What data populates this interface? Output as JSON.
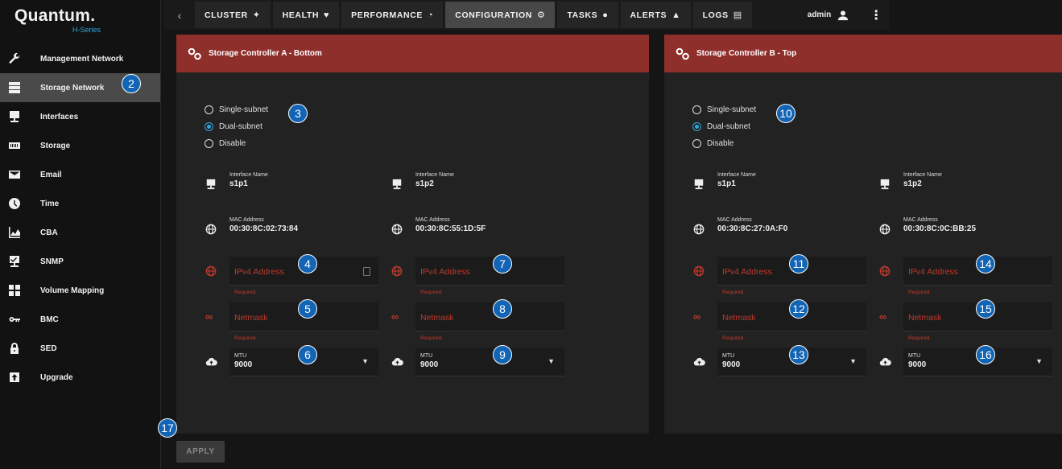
{
  "app": {
    "brand": "Quantum.",
    "series": "H-Series"
  },
  "sidebar": {
    "items": [
      {
        "label": "Management Network",
        "icon": "wrench-icon"
      },
      {
        "label": "Storage Network",
        "icon": "server-icon",
        "active": true
      },
      {
        "label": "Interfaces",
        "icon": "monitor-icon"
      },
      {
        "label": "Storage",
        "icon": "storage-icon"
      },
      {
        "label": "Email",
        "icon": "envelope-icon"
      },
      {
        "label": "Time",
        "icon": "clock-icon"
      },
      {
        "label": "CBA",
        "icon": "chart-icon"
      },
      {
        "label": "SNMP",
        "icon": "snmp-monitor-icon"
      },
      {
        "label": "Volume Mapping",
        "icon": "grid-icon"
      },
      {
        "label": "BMC",
        "icon": "key-icon"
      },
      {
        "label": "SED",
        "icon": "lock-icon"
      },
      {
        "label": "Upgrade",
        "icon": "upload-icon"
      }
    ]
  },
  "topnav": {
    "tabs": [
      {
        "label": "CLUSTER",
        "icon": "cluster-icon"
      },
      {
        "label": "HEALTH",
        "icon": "heart-icon"
      },
      {
        "label": "PERFORMANCE",
        "icon": "gauge-icon"
      },
      {
        "label": "CONFIGURATION",
        "icon": "gears-icon",
        "active": true
      },
      {
        "label": "TASKS",
        "icon": "person-icon"
      },
      {
        "label": "ALERTS",
        "icon": "bell-icon"
      },
      {
        "label": "LOGS",
        "icon": "logs-icon"
      }
    ],
    "user": "admin"
  },
  "controllers": [
    {
      "title": "Storage Controller A - Bottom",
      "radios": [
        "Single-subnet",
        "Dual-subnet",
        "Disable"
      ],
      "selected": 1,
      "ports": [
        {
          "iface_caption": "Interface Name",
          "iface": "s1p1",
          "mac_caption": "MAC Address",
          "mac": "00:30:8C:02:73:84",
          "ipv4_placeholder": "IPv4 Address",
          "netmask_placeholder": "Netmask",
          "required": "Required.",
          "mtu_caption": "MTU",
          "mtu": "9000"
        },
        {
          "iface_caption": "Interface Name",
          "iface": "s1p2",
          "mac_caption": "MAC Address",
          "mac": "00:30:8C:55:1D:5F",
          "ipv4_placeholder": "IPv4 Address",
          "netmask_placeholder": "Netmask",
          "required": "Required.",
          "mtu_caption": "MTU",
          "mtu": "9000"
        }
      ]
    },
    {
      "title": "Storage Controller B - Top",
      "radios": [
        "Single-subnet",
        "Dual-subnet",
        "Disable"
      ],
      "selected": 1,
      "ports": [
        {
          "iface_caption": "Interface Name",
          "iface": "s1p1",
          "mac_caption": "MAC Address",
          "mac": "00:30:8C:27:0A:F0",
          "ipv4_placeholder": "IPv4 Address",
          "netmask_placeholder": "Netmask",
          "required": "Required.",
          "mtu_caption": "MTU",
          "mtu": "9000"
        },
        {
          "iface_caption": "Interface Name",
          "iface": "s1p2",
          "mac_caption": "MAC Address",
          "mac": "00:30:8C:0C:BB:25",
          "ipv4_placeholder": "IPv4 Address",
          "netmask_placeholder": "Netmask",
          "required": "Required.",
          "mtu_caption": "MTU",
          "mtu": "9000"
        }
      ]
    }
  ],
  "callouts": [
    "2",
    "3",
    "4",
    "5",
    "6",
    "7",
    "8",
    "9",
    "10",
    "11",
    "12",
    "13",
    "14",
    "15",
    "16",
    "17"
  ],
  "footer": {
    "apply_label": "APPLY"
  },
  "colors": {
    "accent": "#2fa8e0",
    "header": "#8f2f2c",
    "error": "#c0392b",
    "callout": "#1264b4"
  }
}
